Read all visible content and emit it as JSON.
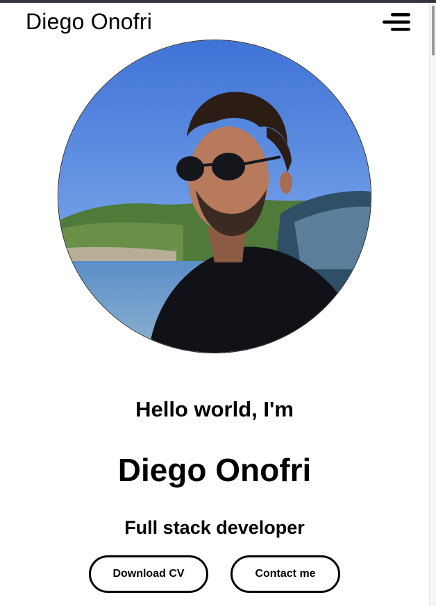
{
  "header": {
    "brand": "Diego Onofri",
    "menu_icon": "hamburger-menu-icon"
  },
  "hero": {
    "photo_icon": "profile-photo",
    "greeting": "Hello world, I'm",
    "name": "Diego Onofri",
    "role": "Full stack developer"
  },
  "actions": {
    "download_cv": "Download CV",
    "contact": "Contact me"
  },
  "colors": {
    "text": "#000000",
    "background": "#ffffff",
    "top_bar": "#2f3440"
  }
}
